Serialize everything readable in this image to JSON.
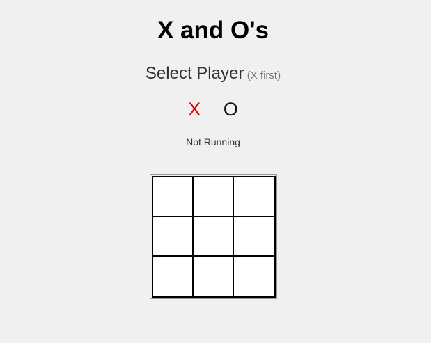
{
  "game": {
    "title": "X and O's",
    "select_label": "Select Player",
    "select_hint": "(X first)",
    "status": "Not Running"
  },
  "players": [
    {
      "label": "X",
      "color": "#e00000",
      "selected": true
    },
    {
      "label": "O",
      "color": "#111111",
      "selected": false
    }
  ],
  "board": {
    "cells": [
      "",
      "",
      "",
      "",
      "",
      "",
      "",
      "",
      ""
    ]
  }
}
